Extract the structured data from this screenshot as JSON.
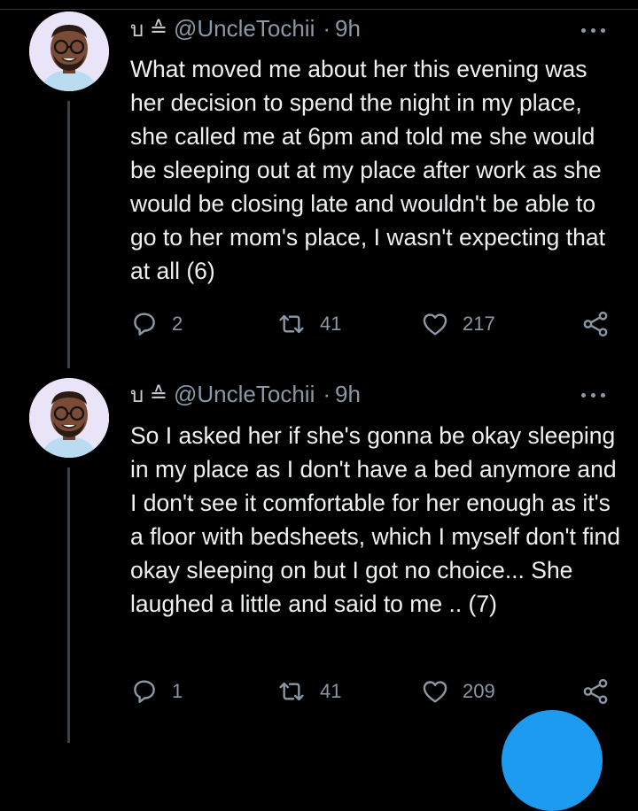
{
  "tweets": [
    {
      "badges": "บ ≙",
      "handle": "@UncleTochii",
      "dot": "·",
      "time": "9h",
      "text": "What moved me about her this evening was her decision to spend the night in my place, she called me at 6pm and told me she would be sleeping out at my place after work as she would be closing late and wouldn't be able to go to her mom's place, I wasn't expecting that at all (6)",
      "replies": "2",
      "retweets": "41",
      "likes": "217"
    },
    {
      "badges": "บ ≙",
      "handle": "@UncleTochii",
      "dot": "·",
      "time": "9h",
      "text": "So I asked her if she's gonna be okay sleeping in my place as I don't have a bed anymore and I don't see it comfortable for her enough as it's a floor with bedsheets, which I myself don't find okay sleeping on but I got no choice... She laughed a little and said to me .. (7)",
      "replies": "1",
      "retweets": "41",
      "likes": "209"
    }
  ],
  "icons": [
    "more-icon",
    "reply-icon",
    "retweet-icon",
    "like-icon",
    "share-icon"
  ],
  "colors": {
    "background": "#000000",
    "text": "#e7e9ea",
    "muted": "#8b98a5",
    "accent": "#1d9bf0"
  }
}
